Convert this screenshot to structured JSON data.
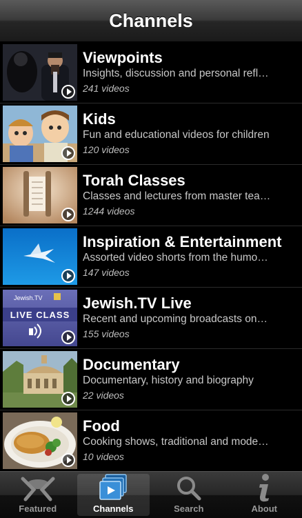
{
  "navbar": {
    "title": "Channels"
  },
  "channels": [
    {
      "name": "Viewpoints",
      "description": "Insights, discussion and personal refl…",
      "count": "241 videos",
      "thumb_icon": "viewpoints-thumbnail"
    },
    {
      "name": "Kids",
      "description": "Fun and educational videos for children",
      "count": "120 videos",
      "thumb_icon": "kids-thumbnail"
    },
    {
      "name": "Torah Classes",
      "description": "Classes and lectures from master tea…",
      "count": "1244 videos",
      "thumb_icon": "torah-scroll-thumbnail"
    },
    {
      "name": "Inspiration & Entertainment",
      "description": "Assorted video shorts from the humo…",
      "count": "147 videos",
      "thumb_icon": "bird-sky-thumbnail"
    },
    {
      "name": "Jewish.TV Live",
      "description": "Recent and upcoming broadcasts on…",
      "count": "155 videos",
      "thumb_icon": "live-class-thumbnail",
      "thumb_text": {
        "brand": "Jewish.TV",
        "banner": "LIVE CLASS"
      }
    },
    {
      "name": "Documentary",
      "description": "Documentary, history and biography",
      "count": "22 videos",
      "thumb_icon": "building-thumbnail"
    },
    {
      "name": "Food",
      "description": "Cooking shows, traditional and mode…",
      "count": "10 videos",
      "thumb_icon": "food-plate-thumbnail"
    }
  ],
  "tabbar": {
    "items": [
      {
        "label": "Featured",
        "icon": "featured-icon",
        "active": false
      },
      {
        "label": "Channels",
        "icon": "channels-icon",
        "active": true
      },
      {
        "label": "Search",
        "icon": "search-icon",
        "active": false
      },
      {
        "label": "About",
        "icon": "about-info-icon",
        "active": false
      }
    ]
  },
  "colors": {
    "background": "#000000",
    "active_tab_label": "#ffffff",
    "inactive_tab_label": "#999999",
    "accent_blue": "#3a8fd8"
  }
}
